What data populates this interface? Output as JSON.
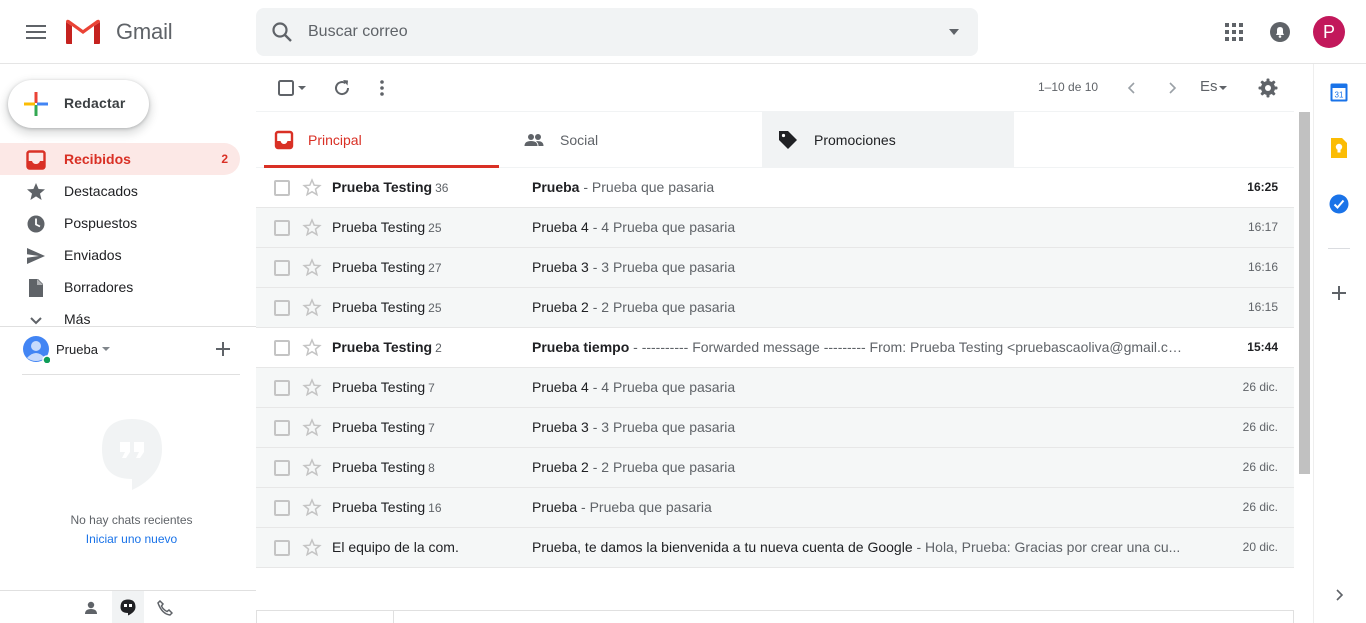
{
  "header": {
    "logo_text": "Gmail",
    "search_placeholder": "Buscar correo",
    "avatar_letter": "P"
  },
  "sidebar": {
    "compose_label": "Redactar",
    "items": [
      {
        "label": "Recibidos",
        "count": "2"
      },
      {
        "label": "Destacados",
        "count": ""
      },
      {
        "label": "Pospuestos",
        "count": ""
      },
      {
        "label": "Enviados",
        "count": ""
      },
      {
        "label": "Borradores",
        "count": ""
      },
      {
        "label": "Más",
        "count": ""
      }
    ]
  },
  "chat": {
    "user_name": "Prueba",
    "no_chats": "No hay chats recientes",
    "start_new": "Iniciar uno nuevo"
  },
  "toolbar": {
    "pager": "1–10 de 10",
    "lang": "Es"
  },
  "tabs": [
    {
      "label": "Principal"
    },
    {
      "label": "Social"
    },
    {
      "label": "Promociones"
    }
  ],
  "messages": [
    {
      "sender": "Prueba Testing",
      "count": "36",
      "subject": "Prueba",
      "snippet": " - Prueba que pasaria",
      "date": "16:25",
      "unread": true
    },
    {
      "sender": "Prueba Testing",
      "count": "25",
      "subject": "Prueba 4",
      "snippet": " - 4 Prueba que pasaria",
      "date": "16:17",
      "unread": false
    },
    {
      "sender": "Prueba Testing",
      "count": "27",
      "subject": "Prueba 3",
      "snippet": " - 3 Prueba que pasaria",
      "date": "16:16",
      "unread": false
    },
    {
      "sender": "Prueba Testing",
      "count": "25",
      "subject": "Prueba 2",
      "snippet": " - 2 Prueba que pasaria",
      "date": "16:15",
      "unread": false
    },
    {
      "sender": "Prueba Testing",
      "count": "2",
      "subject": "Prueba tiempo",
      "snippet": " - ---------- Forwarded message --------- From: Prueba Testing <pruebascaoliva@gmail.co...",
      "date": "15:44",
      "unread": true
    },
    {
      "sender": "Prueba Testing",
      "count": "7",
      "subject": "Prueba 4",
      "snippet": " - 4 Prueba que pasaria",
      "date": "26 dic.",
      "unread": false
    },
    {
      "sender": "Prueba Testing",
      "count": "7",
      "subject": "Prueba 3",
      "snippet": " - 3 Prueba que pasaria",
      "date": "26 dic.",
      "unread": false
    },
    {
      "sender": "Prueba Testing",
      "count": "8",
      "subject": "Prueba 2",
      "snippet": " - 2 Prueba que pasaria",
      "date": "26 dic.",
      "unread": false
    },
    {
      "sender": "Prueba Testing",
      "count": "16",
      "subject": "Prueba",
      "snippet": " - Prueba que pasaria",
      "date": "26 dic.",
      "unread": false
    },
    {
      "sender": "El equipo de la com.",
      "count": "",
      "subject": "Prueba, te damos la bienvenida a tu nueva cuenta de Google",
      "snippet": " - Hola, Prueba: Gracias por crear una cu...",
      "date": "20 dic.",
      "unread": false
    }
  ],
  "colors": {
    "accent_red": "#d93025",
    "active_bg": "#fce8e6",
    "avatar_bg": "#c2185b",
    "link_blue": "#1a73e8"
  }
}
